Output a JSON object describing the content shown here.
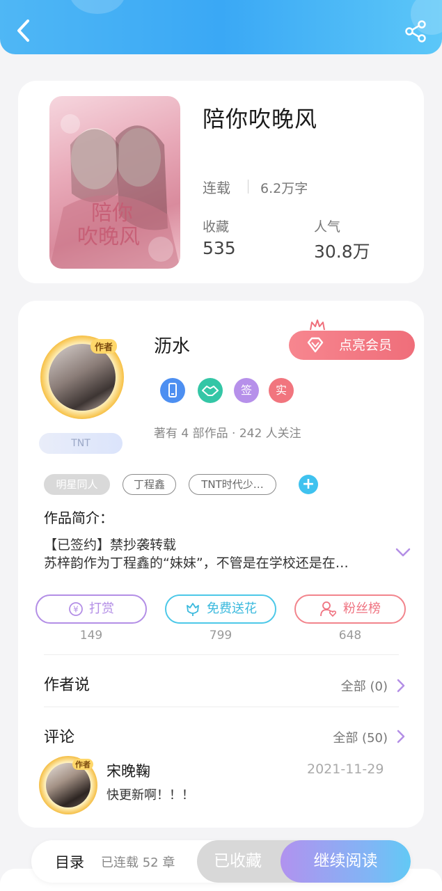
{
  "book": {
    "title": "陪你吹晚风",
    "status": "连载",
    "words": "6.2万字",
    "favorites_label": "收藏",
    "favorites_value": "535",
    "popularity_label": "人气",
    "popularity_value": "30.8万"
  },
  "author": {
    "name": "沥水",
    "avatar_tag": "作者",
    "fan_badge": "TNT",
    "vip_button": "点亮会员",
    "badges": [
      {
        "icon": "phone-badge-icon",
        "text": "",
        "color": "#4d8ff1"
      },
      {
        "icon": "handshake-badge-icon",
        "text": "",
        "color": "#34c6a6"
      },
      {
        "icon": "signed-badge-icon",
        "text": "签",
        "color": "#b690ea"
      },
      {
        "icon": "verified-badge-icon",
        "text": "实",
        "color": "#f1757e"
      }
    ],
    "stats": "著有 4 部作品 · 242 人关注"
  },
  "tags": [
    "明星同人",
    "丁程鑫",
    "TNT时代少…"
  ],
  "intro": {
    "title": "作品简介：",
    "line1": "【已签约】禁抄袭转载",
    "line2": "苏梓韵作为丁程鑫的“妹妹”，不管是在学校还是在…"
  },
  "actions": [
    {
      "label": "打赏",
      "count": "149",
      "color": "#b38ee6",
      "icon": "yuan-icon"
    },
    {
      "label": "免费送花",
      "count": "799",
      "color": "#4cc8e8",
      "icon": "flower-icon"
    },
    {
      "label": "粉丝榜",
      "count": "648",
      "color": "#f2848c",
      "icon": "fans-icon"
    }
  ],
  "author_says": {
    "title": "作者说",
    "link": "全部 (0)"
  },
  "comments": {
    "title": "评论",
    "link": "全部 (50)",
    "items": [
      {
        "name": "宋晚鞠",
        "tag": "作者",
        "date": "2021-11-29",
        "text": "快更新啊！！！"
      }
    ]
  },
  "bottom_bar": {
    "toc": "目录",
    "chapters": "已连载 52 章",
    "favorited": "已收藏",
    "continue": "继续阅读"
  },
  "colors": {
    "header": "#3aa8f5",
    "vip": "#ef6e7a",
    "accent_purple": "#b38ee6"
  }
}
